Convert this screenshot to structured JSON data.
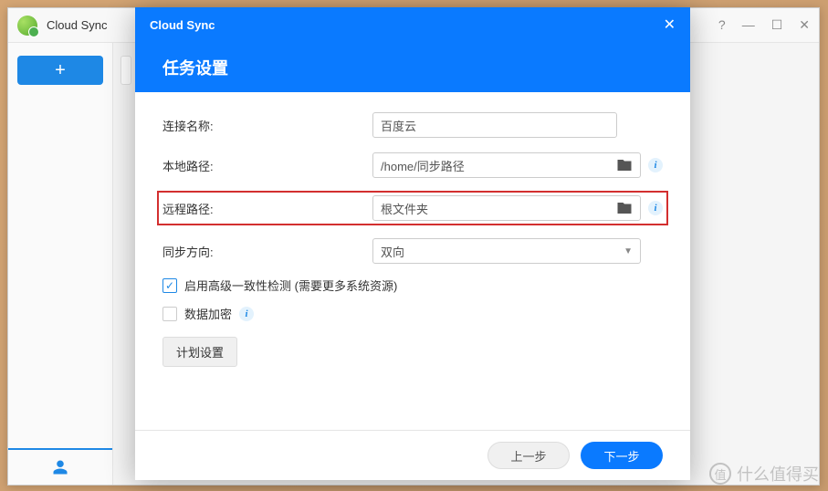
{
  "window": {
    "title": "Cloud Sync",
    "help": "?",
    "min": "—",
    "max": "☐",
    "close": "✕"
  },
  "sidebar": {
    "add": "+"
  },
  "modal": {
    "header_title": "Cloud Sync",
    "close": "✕",
    "section_title": "任务设置",
    "fields": {
      "conn_name_label": "连接名称:",
      "conn_name_value": "百度云",
      "local_path_label": "本地路径:",
      "local_path_value": "/home/同步路径",
      "remote_path_label": "远程路径:",
      "remote_path_value": "根文件夹",
      "sync_dir_label": "同步方向:",
      "sync_dir_value": "双向"
    },
    "checkboxes": {
      "advanced_check_label": "启用高级一致性检测 (需要更多系统资源)",
      "encrypt_label": "数据加密"
    },
    "plan_button": "计划设置",
    "footer": {
      "prev": "上一步",
      "next": "下一步"
    }
  },
  "watermark": {
    "icon": "值",
    "text": "什么值得买"
  }
}
